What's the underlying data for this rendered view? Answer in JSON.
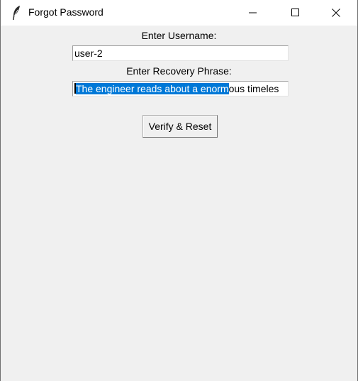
{
  "window": {
    "title": "Forgot Password",
    "title_icon": "feather-icon",
    "controls": [
      "minimize-icon",
      "maximize-icon",
      "close-icon"
    ]
  },
  "form": {
    "username_label": "Enter Username:",
    "username_value": "user-2",
    "phrase_label": "Enter Recovery Phrase:",
    "phrase_selected": "The engineer reads about a enorm",
    "phrase_rest": "ous timeles",
    "submit_label": "Verify & Reset"
  },
  "colors": {
    "selection": "#0078d7",
    "background": "#f0f0f0"
  }
}
